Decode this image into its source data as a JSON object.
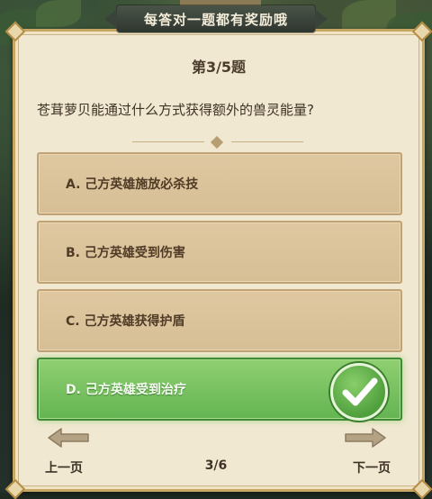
{
  "banner": {
    "title": "每答对一题都有奖励哦"
  },
  "quiz": {
    "question_number": "第3/5题",
    "question": "苍茸萝贝能通过什么方式获得额外的兽灵能量?",
    "options": [
      {
        "label": "A. 己方英雄施放必杀技",
        "state": "normal"
      },
      {
        "label": "B. 己方英雄受到伤害",
        "state": "normal"
      },
      {
        "label": "C. 己方英雄获得护盾",
        "state": "normal"
      },
      {
        "label": "D. 己方英雄受到治疗",
        "state": "correct"
      }
    ],
    "correct_icon": "check-icon"
  },
  "footer": {
    "prev_label": "上一页",
    "next_label": "下一页",
    "page_indicator": "3/6",
    "prev_icon": "arrow-left-icon",
    "next_icon": "arrow-right-icon"
  },
  "colors": {
    "parchment": "#f1e8d2",
    "option_bg": "#d8bf96",
    "correct_green": "#64b452",
    "frame_gold": "#c8a765"
  }
}
